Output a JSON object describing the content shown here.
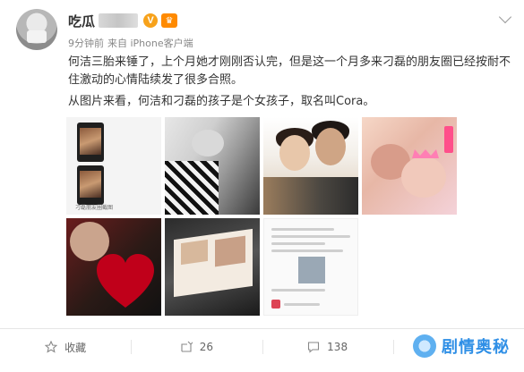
{
  "header": {
    "username": "吃瓜",
    "meta_time": "9分钟前",
    "meta_source": "来自 iPhone客户端",
    "v_badge": "V",
    "crown_badge": "♛"
  },
  "content": {
    "paragraph1": "何洁三胎来锤了，上个月她才刚刚否认完，但是这一个月多来刁磊的朋友圈已经按耐不住激动的心情陆续发了很多合照。",
    "paragraph2": "从图片来看，何洁和刁磊的孩子是个女孩子，取名叫Cora。"
  },
  "images": [
    {
      "name": "image-1",
      "caption": "刁磊朋友圈截图"
    },
    {
      "name": "image-2"
    },
    {
      "name": "image-3"
    },
    {
      "name": "image-4"
    },
    {
      "name": "image-5"
    },
    {
      "name": "image-6"
    },
    {
      "name": "image-7"
    }
  ],
  "actions": {
    "favorite": {
      "icon": "star-icon",
      "label": "收藏"
    },
    "repost": {
      "icon": "repost-icon",
      "count": "26"
    },
    "comment": {
      "icon": "comment-icon",
      "count": "138"
    }
  },
  "watermark": {
    "text": "剧情奥秘"
  },
  "colors": {
    "accent": "#f7a21b",
    "watermark": "#2f8fe6"
  }
}
